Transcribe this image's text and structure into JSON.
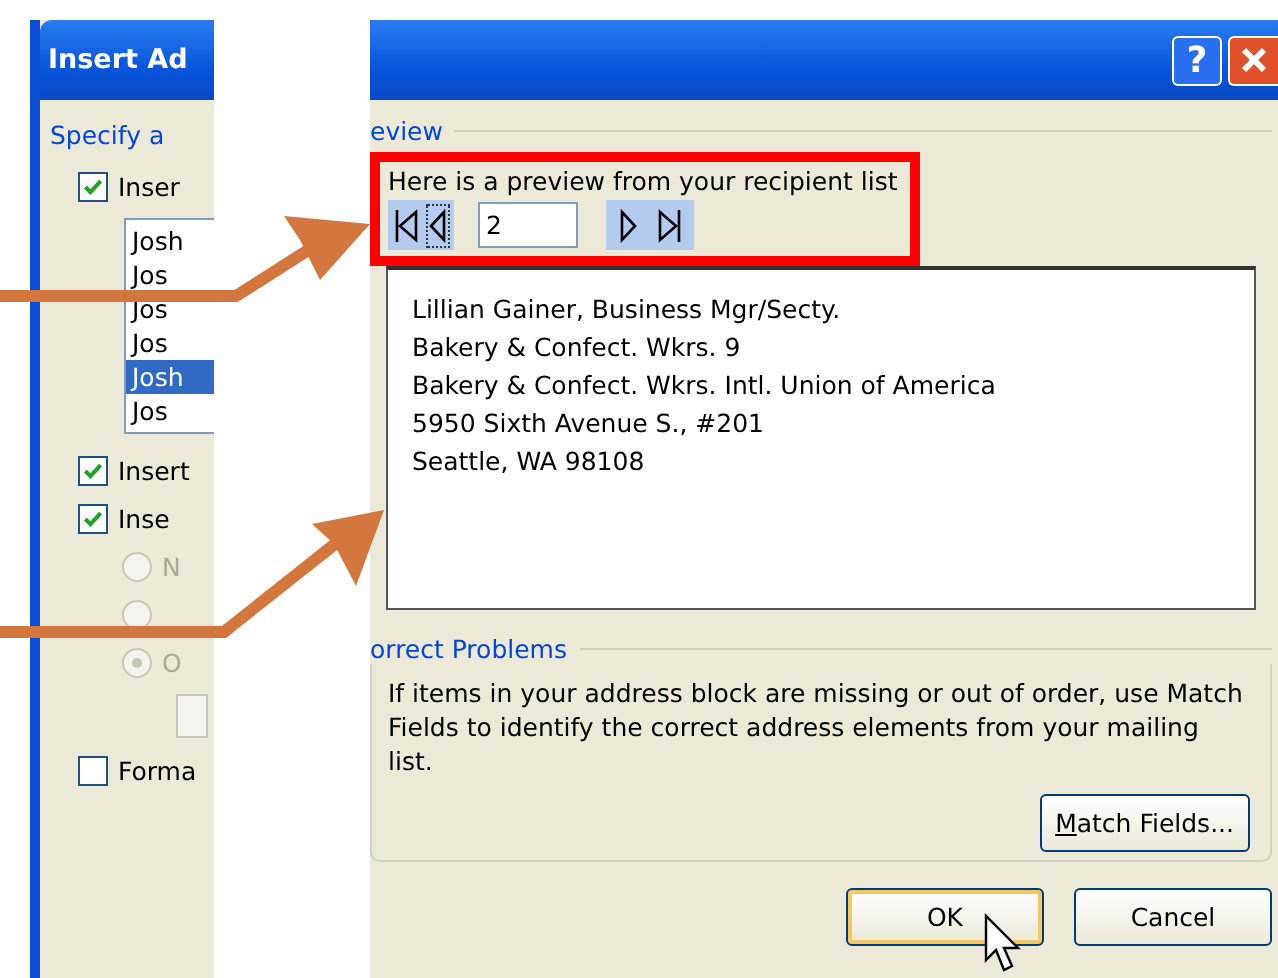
{
  "left_fragment": {
    "title": "Insert Ad",
    "group_label": "Specify a",
    "controls": [
      {
        "kind": "checkbox",
        "label": "Inser",
        "checked": true,
        "disabled": false
      },
      {
        "kind": "list",
        "items": [
          {
            "text": "Josh",
            "selected": false
          },
          {
            "text": "Jos",
            "selected": false
          },
          {
            "text": "Jos",
            "selected": false
          },
          {
            "text": "Jos",
            "selected": false
          },
          {
            "text": "Josh",
            "selected": true
          },
          {
            "text": "Jos",
            "selected": false
          }
        ]
      },
      {
        "kind": "checkbox",
        "label": "Insert",
        "checked": true,
        "disabled": false
      },
      {
        "kind": "checkbox",
        "label": "Inse",
        "checked": true,
        "disabled": false
      },
      {
        "kind": "radio",
        "label": "N",
        "selected": false,
        "disabled": true
      },
      {
        "kind": "radio",
        "selected": false,
        "disabled": true
      },
      {
        "kind": "radio",
        "label": "O",
        "selected": true,
        "disabled": true
      },
      {
        "kind": "subbox",
        "disabled": true
      },
      {
        "kind": "checkbox",
        "label": "Forma",
        "checked": false,
        "disabled": false
      }
    ]
  },
  "right_fragment": {
    "help_button": "?",
    "preview": {
      "group_label": "eview",
      "prompt": "Here is a preview from your recipient list",
      "record": "2",
      "address_lines": [
        "Lillian Gainer, Business Mgr/Secty.",
        "Bakery & Confect. Wkrs. 9",
        "Bakery & Confect. Wkrs. Intl. Union of America",
        "5950 Sixth Avenue S., #201",
        "Seattle, WA 98108"
      ]
    },
    "correct_problems": {
      "group_label": "orrect Problems",
      "text": "If items in your address block are missing or out of order, use Match Fields to identify the correct address elements from your mailing list.",
      "match_button": "Match Fields..."
    },
    "buttons": [
      {
        "label": "OK",
        "default": true
      },
      {
        "label": "Cancel",
        "default": false
      }
    ]
  }
}
